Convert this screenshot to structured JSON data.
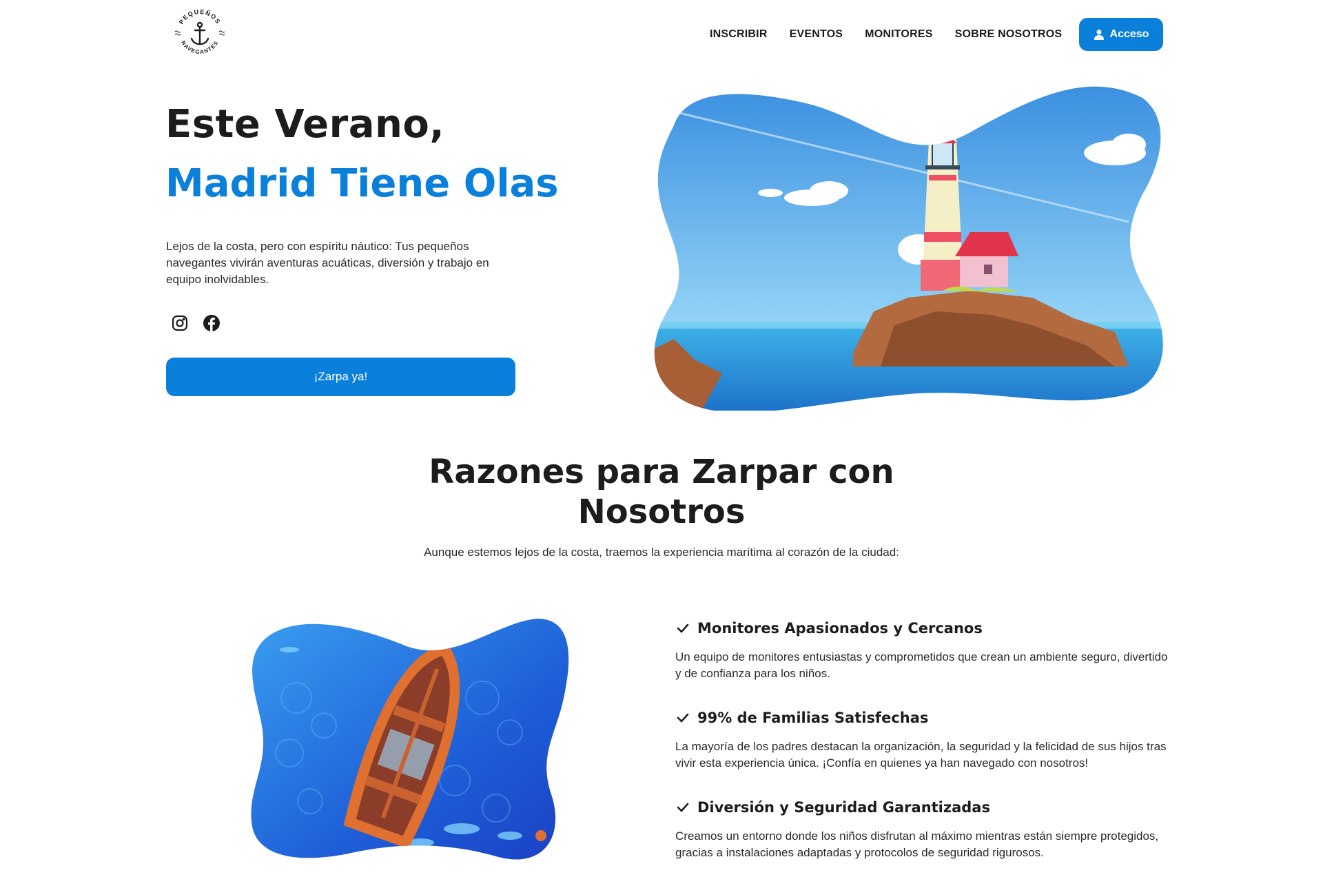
{
  "header": {
    "logo": {
      "top_text": "PEQUEÑOS",
      "bottom_text": "NAVEGANTES",
      "icon": "anchor-icon"
    },
    "nav": [
      "INSCRIBIR",
      "EVENTOS",
      "MONITORES",
      "SOBRE NOSOTROS"
    ],
    "login": {
      "label": "Acceso",
      "icon": "user-icon"
    }
  },
  "hero": {
    "title_line1": "Este Verano,",
    "title_line2": "Madrid Tiene Olas",
    "description": "Lejos de la costa, pero con espíritu náutico: Tus pequeños navegantes vivirán aventuras acuáticas, diversión y trabajo en equipo inolvidables.",
    "socials": [
      "instagram-icon",
      "facebook-icon"
    ],
    "cta": "¡Zarpa ya!"
  },
  "reasons": {
    "title": "Razones para Zarpar con Nosotros",
    "subtitle": "Aunque estemos lejos de la costa, traemos la experiencia marítima al corazón de la ciudad:",
    "items": [
      {
        "title": "Monitores Apasionados y Cercanos",
        "text": "Un equipo de monitores entusiastas y comprometidos que crean un ambiente seguro, divertido y de confianza para los niños."
      },
      {
        "title": "99% de Familias Satisfechas",
        "text": "La mayoría de los padres destacan la organización, la seguridad y la felicidad de sus hijos tras vivir esta experiencia única. ¡Confía en quienes ya han navegado con nosotros!"
      },
      {
        "title": "Diversión y Seguridad Garantizadas",
        "text": "Creamos un entorno donde los niños disfrutan al máximo mientras están siempre protegidos, gracias a instalaciones adaptadas y protocolos de seguridad rigurosos."
      }
    ]
  },
  "colors": {
    "accent": "#0a80db",
    "text": "#1c1c1c"
  }
}
